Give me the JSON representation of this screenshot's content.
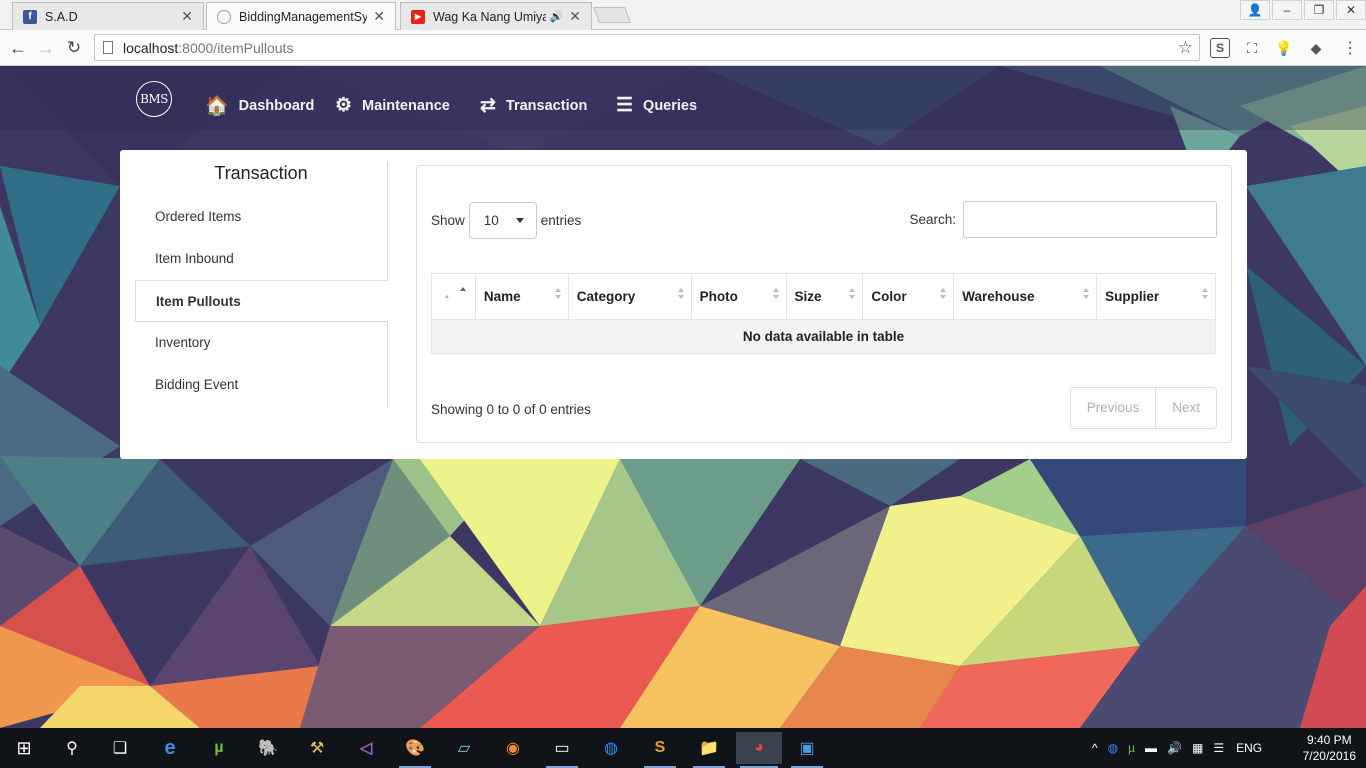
{
  "browser": {
    "tabs": [
      {
        "title": "S.A.D",
        "favicon": "facebook-icon",
        "color": "#3b5998",
        "active": false
      },
      {
        "title": "BiddingManagementSyst",
        "favicon": "page-loading-icon",
        "color": "#9e9e9e",
        "active": true
      },
      {
        "title": "Wag Ka Nang Umiyak",
        "favicon": "youtube-icon",
        "color": "#e62117",
        "active": false,
        "audio": "🔊"
      }
    ],
    "url_host": "localhost",
    "url_path": ":8000/itemPullouts",
    "close_glyph": "✕"
  },
  "navbar": {
    "logo": "BMS",
    "items": [
      {
        "label": "Dashboard",
        "icon": "home-icon",
        "glyph": "🏠"
      },
      {
        "label": "Maintenance",
        "icon": "gears-icon",
        "glyph": "⚙"
      },
      {
        "label": "Transaction",
        "icon": "exchange-icon",
        "glyph": "⇄"
      },
      {
        "label": "Queries",
        "icon": "list-icon",
        "glyph": "☰"
      }
    ]
  },
  "sidebar": {
    "title": "Transaction",
    "items": [
      {
        "label": "Ordered Items"
      },
      {
        "label": "Item Inbound"
      },
      {
        "label": "Item Pullouts",
        "active": true
      },
      {
        "label": "Inventory"
      },
      {
        "label": "Bidding Event"
      }
    ]
  },
  "datatable": {
    "show_label": "Show",
    "length_value": "10",
    "entries_label": "entries",
    "search_label": "Search:",
    "search_value": "",
    "columns": [
      "",
      "Name",
      "Category",
      "Photo",
      "Size",
      "Color",
      "Warehouse",
      "Supplier"
    ],
    "empty_message": "No data available in table",
    "info": "Showing 0 to 0 of 0 entries",
    "prev_label": "Previous",
    "next_label": "Next"
  },
  "taskbar": {
    "language": "ENG",
    "time": "9:40 PM",
    "date": "7/20/2016",
    "apps": [
      "start-icon",
      "search-icon",
      "task-view-icon",
      "edge-icon",
      "utorrent-icon",
      "pgadmin-icon",
      "tools-icon",
      "visual-studio-icon",
      "paint-icon",
      "notepad-icon",
      "firefox-icon",
      "cmd-icon",
      "messenger-icon",
      "sublime-icon",
      "explorer-icon",
      "chrome-icon",
      "app-icon"
    ]
  }
}
